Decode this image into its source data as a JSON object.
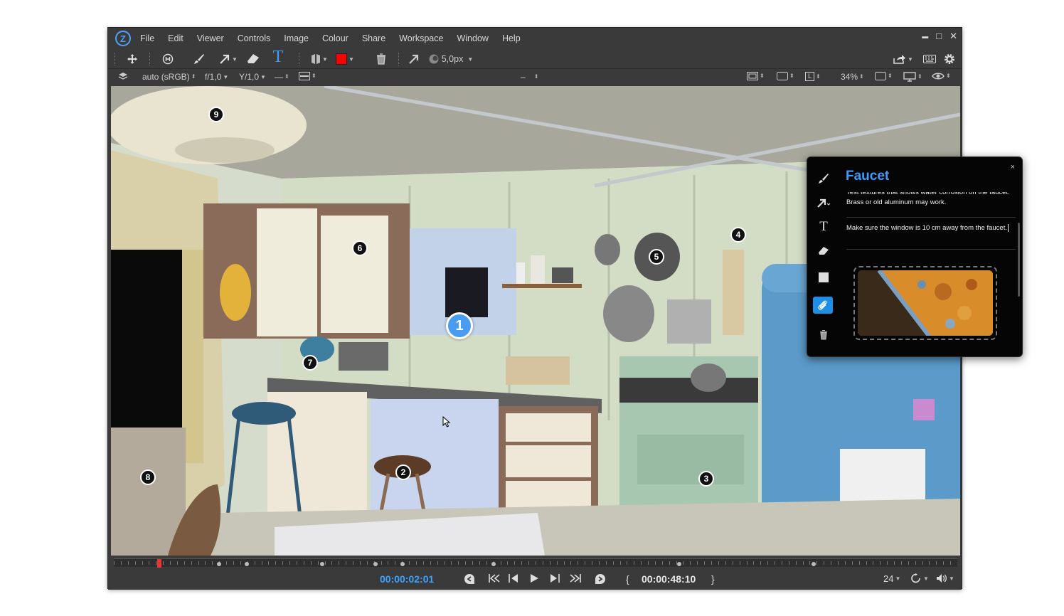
{
  "app": {
    "logo": "Z",
    "menu": [
      "File",
      "Edit",
      "Viewer",
      "Controls",
      "Image",
      "Colour",
      "Share",
      "Workspace",
      "Window",
      "Help"
    ],
    "window_controls": {
      "minimize": "▬",
      "maximize": "□",
      "close": "✕"
    }
  },
  "toolbar": {
    "text_tool": "T",
    "brush_size": "5,0px",
    "color_swatch": "#ff0000",
    "icons": [
      "move-icon",
      "hotkey-icon",
      "brush-icon",
      "arrow-icon",
      "eraser-icon",
      "text-icon",
      "shape-icon",
      "color-swatch",
      "trash-icon",
      "pointer-icon",
      "brush-size-icon",
      "share-icon",
      "keyboard-icon",
      "settings-icon"
    ]
  },
  "viewbar": {
    "color_space": "auto (sRGB)",
    "fstop": "f/1,0",
    "gamma": "Y/1,0",
    "dash_a": "—",
    "center_dash": "–",
    "zoom": "34%",
    "l_label": "L"
  },
  "viewport": {
    "markers": [
      "1",
      "2",
      "3",
      "4",
      "5",
      "6",
      "7",
      "8",
      "9"
    ],
    "active_marker": "1"
  },
  "timeline": {
    "progress": 0.054,
    "keyframes": [
      0.054,
      0.125,
      0.158,
      0.247,
      0.31,
      0.342,
      0.45,
      0.67,
      0.83
    ]
  },
  "transport": {
    "current_time": "00:00:02:01",
    "total_time": "00:00:48:10",
    "fps": "24",
    "open_brace": "{",
    "close_brace": "}"
  },
  "annotation": {
    "title": "Faucet",
    "close": "×",
    "note1": "Test textures that shows water corrosion on the faucet. Brass or old aluminum may work.",
    "note2": "Make sure the window is 10 cm away from the faucet.",
    "active_tool": "attach-icon"
  },
  "colors": {
    "accent": "#3f9bff",
    "marker_active": "#4a9cf0",
    "panel_bg": "#050505",
    "app_bg": "#3a3a3a"
  }
}
